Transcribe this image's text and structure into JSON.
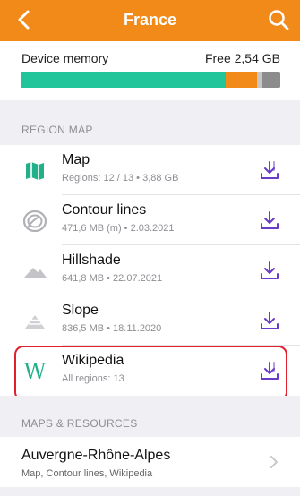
{
  "header": {
    "title": "France",
    "back_icon": "chevron-left-icon",
    "search_icon": "search-icon",
    "background": "#f28a1a"
  },
  "memory": {
    "label": "Device memory",
    "free": "Free 2,54 GB",
    "segments": [
      {
        "name": "maps",
        "fraction": 0.79,
        "color": "#22c59a"
      },
      {
        "name": "other",
        "fraction": 0.12,
        "color": "#f28a1a"
      },
      {
        "name": "system",
        "fraction": 0.02,
        "color": "#c7c7c7"
      },
      {
        "name": "free",
        "fraction": 0.07,
        "color": "#8c8c8c"
      }
    ]
  },
  "region_map": {
    "header": "REGION MAP",
    "items": [
      {
        "name": "Map",
        "subtitle": "Regions: 12 / 13  •  3,88 GB",
        "icon": "map-icon",
        "action_icon": "download-icon"
      },
      {
        "name": "Contour lines",
        "subtitle": "471,6 MB (m)  •  2.03.2021",
        "icon": "contour-lines-icon",
        "action_icon": "download-icon"
      },
      {
        "name": "Hillshade",
        "subtitle": "641,8 MB  •  22.07.2021",
        "icon": "hillshade-icon",
        "action_icon": "download-icon"
      },
      {
        "name": "Slope",
        "subtitle": "836,5 MB  •  18.11.2020",
        "icon": "slope-icon",
        "action_icon": "download-icon"
      },
      {
        "name": "Wikipedia",
        "subtitle": "All regions: 13",
        "icon": "wikipedia-icon",
        "action_icon": "download-icon"
      }
    ]
  },
  "maps_resources": {
    "header": "MAPS & RESOURCES",
    "items": [
      {
        "name": "Auvergne-Rhône-Alpes",
        "subtitle": "Map, Contour lines, Wikipedia",
        "icon": "chevron-right-icon"
      }
    ]
  },
  "colors": {
    "accent": "#f28a1a",
    "download": "#6a3bc7",
    "highlight": "#e0202f"
  }
}
